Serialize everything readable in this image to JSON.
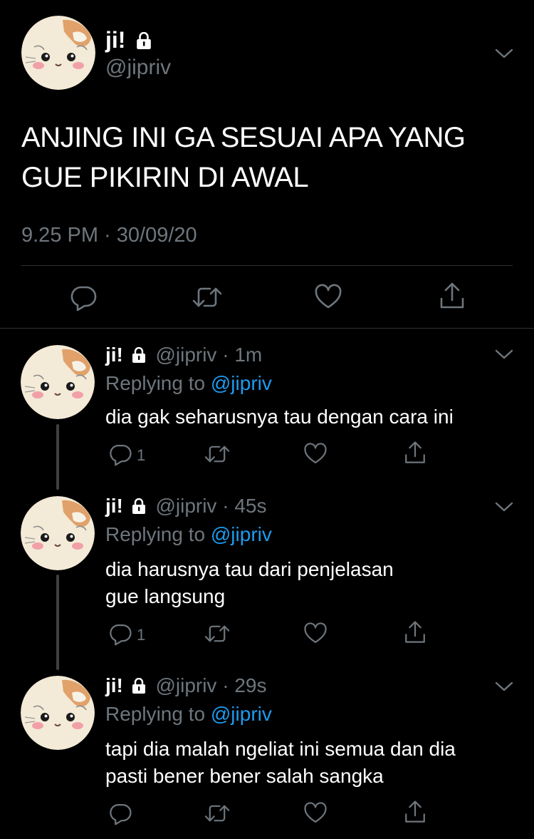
{
  "main_tweet": {
    "author_name": "ji!",
    "handle": "@jipriv",
    "text_line1": "ANJING INI GA SESUAI APA YANG",
    "text_line2": "GUE PIKIRIN DI AWAL",
    "timestamp": "9.25 PM · 30/09/20"
  },
  "replies": [
    {
      "author_name": "ji!",
      "handle": "@jipriv",
      "separator": "·",
      "time": "1m",
      "replying_label": "Replying to",
      "replying_handle": "@jipriv",
      "text_line1": "dia gak seharusnya tau dengan cara ini",
      "text_line2": "",
      "reply_count": "1"
    },
    {
      "author_name": "ji!",
      "handle": "@jipriv",
      "separator": "·",
      "time": "45s",
      "replying_label": "Replying to",
      "replying_handle": "@jipriv",
      "text_line1": "dia harusnya tau dari penjelasan",
      "text_line2": "gue langsung",
      "reply_count": "1"
    },
    {
      "author_name": "ji!",
      "handle": "@jipriv",
      "separator": "·",
      "time": "29s",
      "replying_label": "Replying to",
      "replying_handle": "@jipriv",
      "text_line1": "tapi dia malah ngeliat ini semua dan dia",
      "text_line2": "pasti bener bener salah sangka",
      "reply_count": ""
    }
  ],
  "icons": {
    "reply": "speech-bubble",
    "retweet": "retweet-arrows",
    "like": "heart-outline",
    "share": "share-upload",
    "more": "chevron-down",
    "protected": "lock"
  },
  "colors": {
    "background": "#000000",
    "text": "#ffffff",
    "muted": "#6e767d",
    "link": "#1d9bf0",
    "divider": "#2f3336"
  }
}
